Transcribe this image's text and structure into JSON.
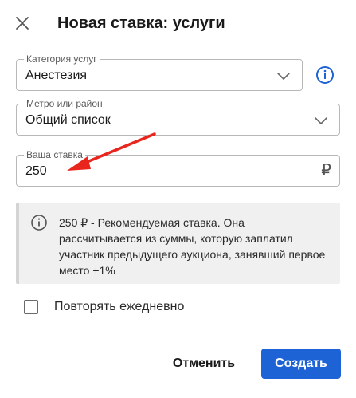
{
  "dialog": {
    "title": "Новая ставка: услуги",
    "close_icon": "close-icon"
  },
  "fields": {
    "category": {
      "label": "Категория услуг",
      "value": "Анестезия",
      "icon": "chevron-down-icon"
    },
    "metro": {
      "label": "Метро или район",
      "value": "Общий список",
      "icon": "chevron-down-icon"
    },
    "bid": {
      "label": "Ваша ставка",
      "value": "250",
      "currency": "₽"
    }
  },
  "info_button_icon": "info-icon",
  "notice": {
    "icon": "info-icon",
    "text": "250 ₽ - Рекомендуемая ставка. Она рассчитывается из суммы, которую заплатил участник предыдущего аукциона, занявший первое место +1%"
  },
  "repeat_daily": {
    "label": "Повторять ежедневно",
    "checked": false
  },
  "actions": {
    "cancel_label": "Отменить",
    "create_label": "Создать"
  },
  "colors": {
    "primary": "#1e63d6",
    "info_icon": "#1e63d6",
    "annotation_arrow": "#e8261e",
    "notice_bg": "#f0f0f0"
  }
}
